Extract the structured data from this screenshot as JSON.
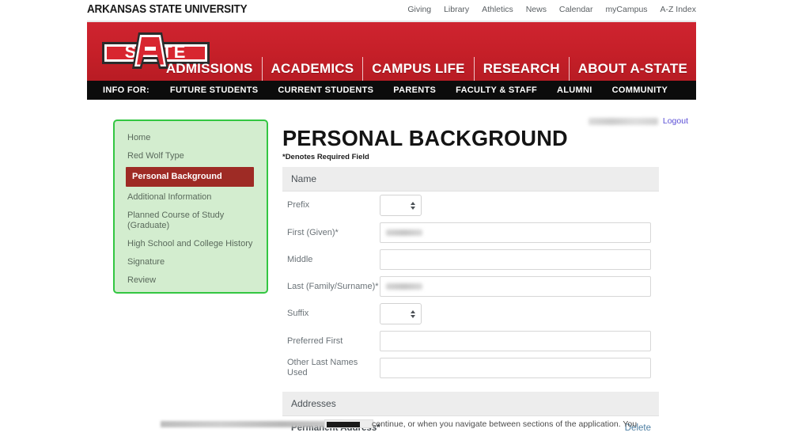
{
  "utility": {
    "university_name": "ARKANSAS STATE UNIVERSITY",
    "links": [
      "Giving",
      "Library",
      "Athletics",
      "News",
      "Calendar",
      "myCampus",
      "A-Z Index"
    ]
  },
  "banner": {
    "logo_text": "STATE",
    "brand_red": "#c51f28",
    "main_nav": [
      "ADMISSIONS",
      "ACADEMICS",
      "CAMPUS LIFE",
      "RESEARCH",
      "ABOUT A-STATE"
    ]
  },
  "infobar": {
    "label": "INFO FOR:",
    "items": [
      "FUTURE STUDENTS",
      "CURRENT STUDENTS",
      "PARENTS",
      "FACULTY & STAFF",
      "ALUMNI",
      "COMMUNITY"
    ]
  },
  "account": {
    "user_name": "",
    "logout_label": "Logout",
    "logout_color": "#5b4fd6"
  },
  "sidebar": {
    "border_color": "#33c642",
    "background_color": "#d3edcf",
    "active_color": "#9e2b25",
    "items": [
      {
        "label": "Home",
        "active": false
      },
      {
        "label": "Red Wolf Type",
        "active": false
      },
      {
        "label": "Personal Background",
        "active": true
      },
      {
        "label": "Additional Information",
        "active": false
      },
      {
        "label": "Planned Course of Study (Graduate)",
        "active": false
      },
      {
        "label": "High School and College History",
        "active": false
      },
      {
        "label": "Signature",
        "active": false
      },
      {
        "label": "Review",
        "active": false
      }
    ]
  },
  "main": {
    "page_title": "PERSONAL BACKGROUND",
    "required_note": "*Denotes Required Field",
    "name_section": {
      "heading": "Name",
      "fields": [
        {
          "label": "Prefix",
          "type": "select",
          "value": ""
        },
        {
          "label": "First (Given)*",
          "type": "text",
          "value": "",
          "redacted": true
        },
        {
          "label": "Middle",
          "type": "text",
          "value": "",
          "redacted": false
        },
        {
          "label": "Last (Family/Surname)*",
          "type": "text",
          "value": "",
          "redacted": true
        },
        {
          "label": "Suffix",
          "type": "select",
          "value": ""
        },
        {
          "label": "Preferred First",
          "type": "text",
          "value": "",
          "redacted": false
        },
        {
          "label": "Other Last Names Used",
          "type": "text",
          "value": "",
          "redacted": false
        }
      ]
    },
    "addresses_section": {
      "heading": "Addresses",
      "permanent_label": "Permanent Address*",
      "delete_label": "Delete"
    }
  },
  "overlay_fragment": {
    "text": "continue,  or when you navigate between sections of the application. You"
  }
}
